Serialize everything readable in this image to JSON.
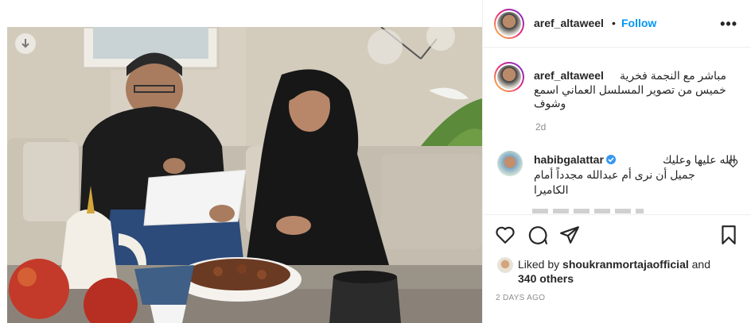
{
  "header": {
    "username": "aref_altaweel",
    "separator": "•",
    "follow_label": "Follow",
    "more_label": "•••"
  },
  "caption": {
    "username": "aref_altaweel",
    "line1": "مباشر مع النجمة فخرية",
    "line2": "خميس من تصوير المسلسل العماني اسمع",
    "line3": "وشوف",
    "time": "2d"
  },
  "comment": {
    "username": "habibgalattar",
    "line1": "الله عليها وعليك",
    "line2": "جميل أن نرى أم عبدالله مجدداً أمام",
    "line3": "الكاميرا"
  },
  "likes": {
    "prefix": "Liked by",
    "user": "shoukranmortajaofficial",
    "and": "and",
    "others": "340 others"
  },
  "post_date": "2 DAYS AGO",
  "colors": {
    "follow_blue": "#0095f6",
    "verified_blue": "#3897f0",
    "meta_grey": "#8e8e8e"
  },
  "icons": [
    "download-icon",
    "more-icon",
    "heart-icon",
    "comment-icon",
    "share-icon",
    "bookmark-icon",
    "verified-icon"
  ]
}
